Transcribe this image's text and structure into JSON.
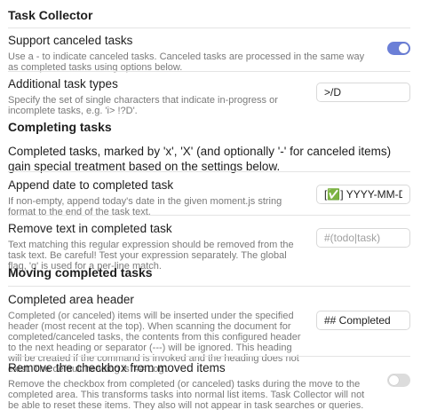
{
  "colors": {
    "toggle_on": "#6b7fd7",
    "toggle_off": "#dcdcdc",
    "description": "#7a7a7a"
  },
  "title": "Task Collector",
  "settings": {
    "support_canceled": {
      "name": "Support canceled tasks",
      "desc": "Use a - to indicate canceled tasks. Canceled tasks are processed in the same way as completed tasks using options below.",
      "enabled": true
    },
    "additional_types": {
      "name": "Additional task types",
      "desc": "Specify the set of single characters that indicate in-progress or incomplete tasks, e.g. 'i> !?D'.",
      "value": ">/D"
    }
  },
  "completing": {
    "heading": "Completing tasks",
    "paragraph": "Completed tasks, marked by 'x', 'X' (and optionally '-' for canceled items) gain special treatment based on the settings below.",
    "append_date": {
      "name": "Append date to completed task",
      "desc": "If non-empty, append today's date in the given moment.js string format to the end of the task text.",
      "value": "[✅] YYYY-MM-DD"
    },
    "remove_text": {
      "name": "Remove text in completed task",
      "desc": "Text matching this regular expression should be removed from the task text. Be careful! Test your expression separately. The global flag, 'g' is used for a per-line match.",
      "placeholder": "#(todo|task)"
    }
  },
  "moving": {
    "heading": "Moving completed tasks",
    "area_header": {
      "name": "Completed area header",
      "desc": "Completed (or canceled) items will be inserted under the specified header (most recent at the top). When scanning the document for completed/canceled tasks, the contents from this configured header to the next heading or separator (---) will be ignored. This heading will be created if the command is invoked and the heading does not exist. The default heading is '## Log'.",
      "value": "## Completed"
    },
    "remove_checkbox": {
      "name": "Remove the checkbox from moved items",
      "desc": "Remove the checkbox from completed (or canceled) tasks during the move to the completed area. This transforms tasks into normal list items. Task Collector will not be able to reset these items. They also will not appear in task searches or queries. The default value is: 'false'.",
      "enabled": false
    }
  }
}
